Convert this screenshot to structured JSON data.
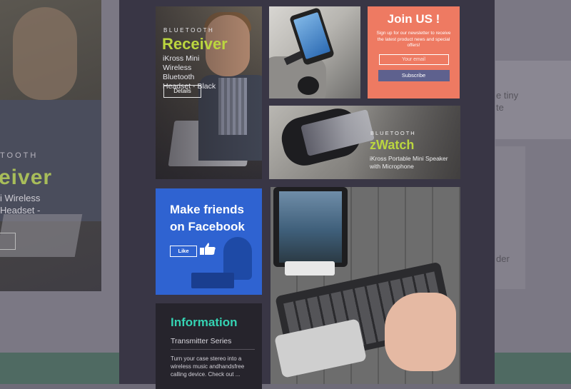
{
  "background": {
    "hero_kicker": "TOOTH",
    "hero_title": "eiver",
    "hero_line1": "i Wireless",
    "hero_line2": "Headset -",
    "right_text1": "e tiny",
    "right_text2": "te",
    "right_text3": "der"
  },
  "tiles": {
    "receiver": {
      "kicker": "BLUETOOTH",
      "title": "Receiver",
      "description": "iKross Mini Wireless Bluetooth Headset - Black",
      "button": "Details"
    },
    "join": {
      "title": "Join US !",
      "description": "Sign up for our newsletter to receive the latest product news and special offers!",
      "email_placeholder": "Your email",
      "button": "Subscribe"
    },
    "zwatch": {
      "kicker": "BLUETOOTH",
      "title": "zWatch",
      "description": "iKross Portable Mini Speaker with Microphone"
    },
    "facebook": {
      "title": "Make friends on Facebook",
      "like": "Like"
    },
    "information": {
      "title": "Information",
      "subtitle": "Transmitter Series",
      "description": "Turn your case stereo into a wireless music andhandsfree calling device. Check out ..."
    }
  },
  "colors": {
    "accent_green": "#bbd63f",
    "join_bg": "#ee7a62",
    "facebook_blue": "#2f63d1",
    "info_teal": "#35d3b3",
    "modal_bg": "#393645"
  }
}
